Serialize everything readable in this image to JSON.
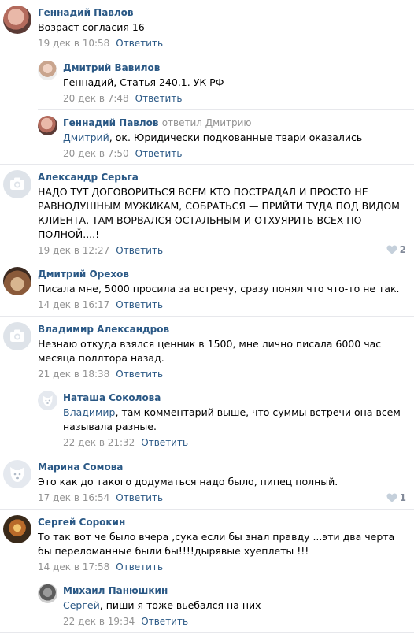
{
  "comments": [
    {
      "author": "Геннадий Павлов",
      "text": "Возраст согласия 16",
      "date": "19 дек в 10:58",
      "reply_label": "Ответить",
      "avatar": "photo-avatar"
    },
    {
      "author": "Дмитрий Вавилов",
      "text": "Геннадий, Статья 240.1. УК РФ",
      "date": "20 дек в 7:48",
      "reply_label": "Ответить",
      "avatar": "photo-avatar"
    },
    {
      "author": "Геннадий Павлов",
      "reply_note": "ответил Дмитрию",
      "mention": "Дмитрий",
      "text": ", ок. Юридически подкованные твари оказались",
      "date": "20 дек в 7:50",
      "reply_label": "Ответить",
      "avatar": "photo-avatar"
    },
    {
      "author": "Александр Серьга",
      "text": "НАДО ТУТ ДОГОВОРИТЬСЯ ВСЕМ КТО ПОСТРАДАЛ И ПРОСТО НЕ РАВНОДУШНЫМ МУЖИКАМ, СОБРАТЬСЯ — ПРИЙТИ ТУДА ПОД ВИДОМ КЛИЕНТА, ТАМ ВОРВАЛСЯ ОСТАЛЬНЫМ И ОТХУЯРИТЬ ВСЕХ ПО ПОЛНОЙ....!",
      "date": "19 дек в 12:27",
      "reply_label": "Ответить",
      "likes": "2",
      "avatar": "camera-icon"
    },
    {
      "author": "Дмитрий Орехов",
      "text": "Писала мне, 5000 просила за встречу, сразу понял что что-то не так.",
      "date": "14 дек в 16:17",
      "reply_label": "Ответить",
      "avatar": "photo-avatar"
    },
    {
      "author": "Владимир Александров",
      "text": "Незнаю откуда взялся ценник в 1500, мне лично писала 6000 час месяца поллтора назад.",
      "date": "21 дек в 18:38",
      "reply_label": "Ответить",
      "avatar": "camera-icon"
    },
    {
      "author": "Наташа Соколова",
      "mention": "Владимир",
      "text": ", там комментарий выше, что суммы встречи она всем называла разные.",
      "date": "22 дек в 21:32",
      "reply_label": "Ответить",
      "avatar": "dog-icon"
    },
    {
      "author": "Марина Сомова",
      "text": "Это как до такого додуматься надо было, пипец полный.",
      "date": "17 дек в 16:54",
      "reply_label": "Ответить",
      "likes": "1",
      "avatar": "dog-icon"
    },
    {
      "author": "Сергей Сорокин",
      "text": "То так вот че было вчера ,сука если бы знал правду ...эти два черта бы переломанные были бы!!!!дырявые хуеплеты !!!",
      "date": "14 дек в 17:58",
      "reply_label": "Ответить",
      "avatar": "photo-avatar"
    },
    {
      "author": "Михаил Панюшкин",
      "mention": "Сергей",
      "text": ", пиши я тоже вьебался на них",
      "date": "22 дек в 19:34",
      "reply_label": "Ответить",
      "avatar": "photo-avatar"
    }
  ],
  "colors": {
    "link": "#2a5885",
    "meta": "#939393",
    "separator": "#e7e8ec",
    "placeholder_bg": "#dee3e9"
  }
}
